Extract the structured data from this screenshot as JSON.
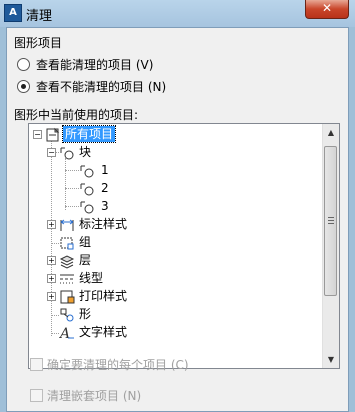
{
  "window": {
    "title": "清理",
    "close_glyph": "✕",
    "app_icon": "app-icon"
  },
  "group_label": "图形项目",
  "options": [
    {
      "label": "查看能清理的项目 (V)",
      "checked": false
    },
    {
      "label": "查看不能清理的项目 (N)",
      "checked": true
    }
  ],
  "tree_label": "图形中当前使用的项目:",
  "tree": {
    "root": "所有项目",
    "block": "块",
    "block_children": [
      "1",
      "2",
      "3"
    ],
    "items": [
      "标注样式",
      "组",
      "层",
      "线型",
      "打印样式",
      "形",
      "文字样式"
    ]
  },
  "checkboxes": [
    {
      "label": "确定要清理的每个项目 (C)",
      "checked": false,
      "enabled": false
    },
    {
      "label": "清理嵌套项目 (N)",
      "checked": false,
      "enabled": false
    }
  ],
  "colors": {
    "selection": "#3399ff",
    "close": "#c9462a",
    "titlebar": "#a6c4df"
  }
}
